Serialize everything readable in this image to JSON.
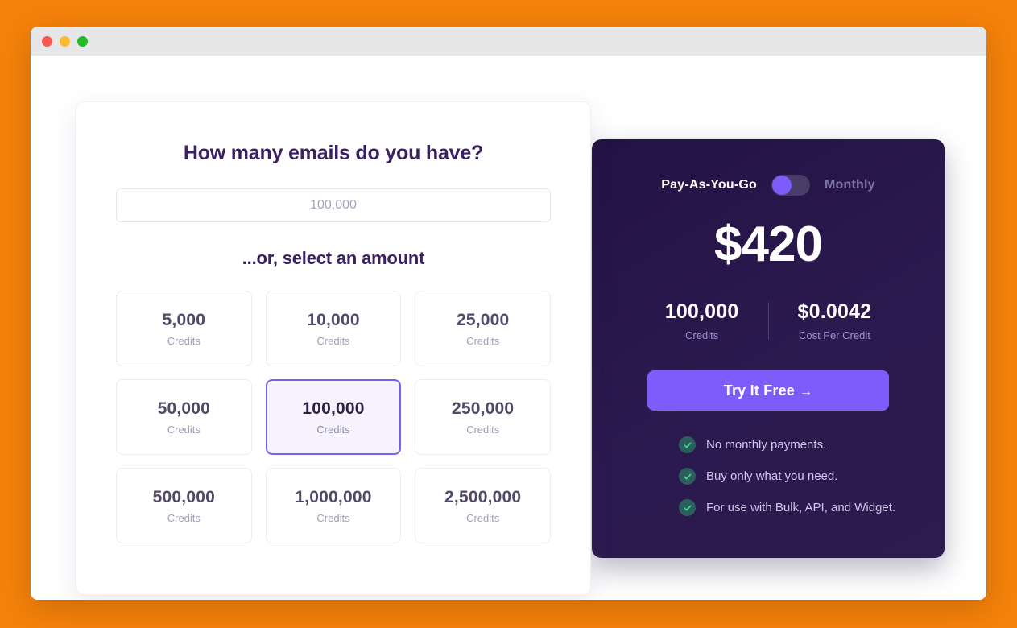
{
  "window": {
    "traffic_lights": [
      "close",
      "minimize",
      "maximize"
    ]
  },
  "selector": {
    "title": "How many emails do you have?",
    "input": {
      "placeholder": "100,000",
      "value": ""
    },
    "subtitle": "...or, select an amount",
    "unit_label": "Credits",
    "options": [
      {
        "amount": "5,000",
        "unit": "Credits",
        "selected": false
      },
      {
        "amount": "10,000",
        "unit": "Credits",
        "selected": false
      },
      {
        "amount": "25,000",
        "unit": "Credits",
        "selected": false
      },
      {
        "amount": "50,000",
        "unit": "Credits",
        "selected": false
      },
      {
        "amount": "100,000",
        "unit": "Credits",
        "selected": true
      },
      {
        "amount": "250,000",
        "unit": "Credits",
        "selected": false
      },
      {
        "amount": "500,000",
        "unit": "Credits",
        "selected": false
      },
      {
        "amount": "1,000,000",
        "unit": "Credits",
        "selected": false
      },
      {
        "amount": "2,500,000",
        "unit": "Credits",
        "selected": false
      }
    ]
  },
  "pricing": {
    "toggle": {
      "left_label": "Pay-As-You-Go",
      "right_label": "Monthly",
      "state": "left"
    },
    "price": "$420",
    "stats": [
      {
        "value": "100,000",
        "label": "Credits"
      },
      {
        "value": "$0.0042",
        "label": "Cost Per Credit"
      }
    ],
    "cta": {
      "label": "Try It Free",
      "arrow": "→"
    },
    "features": [
      "No monthly payments.",
      "Buy only what you need.",
      "For use with Bulk, API, and Widget."
    ]
  },
  "colors": {
    "page_background": "#F5820B",
    "accent_purple": "#7C5CFA",
    "panel_dark": "#2B1A4F",
    "heading": "#3B2063",
    "check_green": "#3DDC97"
  }
}
